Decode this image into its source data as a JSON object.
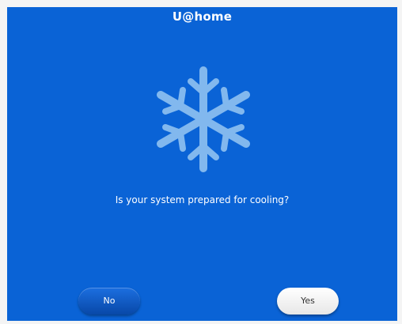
{
  "header": {
    "title": "U@home"
  },
  "main": {
    "icon": "snowflake-icon",
    "question": "Is your system prepared for cooling?"
  },
  "buttons": {
    "no_label": "No",
    "yes_label": "Yes"
  },
  "colors": {
    "background": "#0a63d6",
    "icon": "#82b8ee",
    "no_button": "#0a56c4",
    "yes_button": "#ffffff"
  }
}
